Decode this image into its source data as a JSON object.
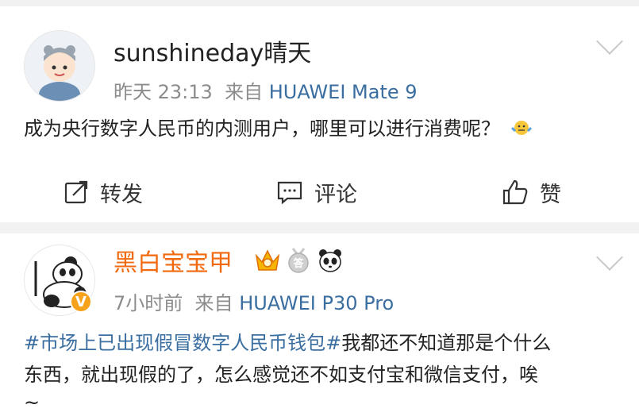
{
  "post1": {
    "username": "sunshineday晴天",
    "time": "昨天 23:13",
    "source_prefix": "来自",
    "device": "HUAWEI Mate 9",
    "content": "成为央行数字人民币的内测用户，哪里可以进行消费呢？"
  },
  "actions": {
    "repost": "转发",
    "comment": "评论",
    "like": "赞"
  },
  "post2": {
    "username": "黑白宝宝甲",
    "time": "7小时前",
    "source_prefix": "来自",
    "device": "HUAWEI P30 Pro",
    "topic": "#市场上已出现假冒数字人民币钱包#",
    "content_line1_rest": "我都还不知道那是个什么",
    "content_line2": "东西，就出现假的了，怎么感觉还不如支付宝和微信支付，唉",
    "content_line3": "~",
    "badge_medal_text": "答"
  },
  "colors": {
    "link_blue": "#3a6ea0",
    "vip_orange": "#f26a10",
    "meta_gray": "#8c8c8c"
  }
}
